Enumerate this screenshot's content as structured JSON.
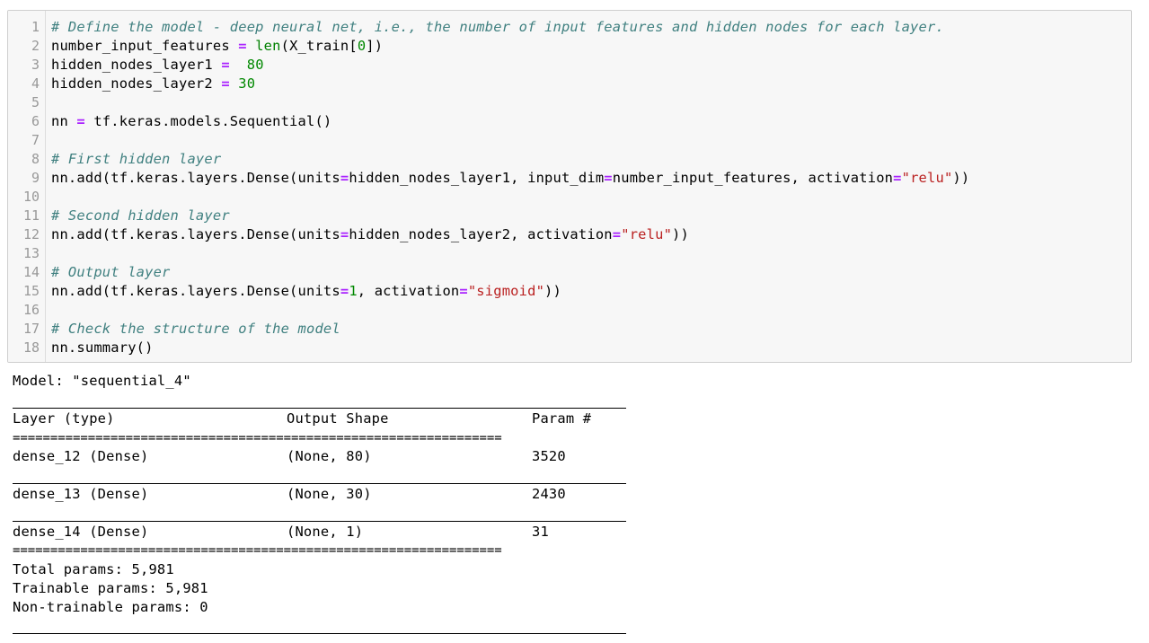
{
  "code_cell": {
    "line_numbers": [
      "1",
      "2",
      "3",
      "4",
      "5",
      "6",
      "7",
      "8",
      "9",
      "10",
      "11",
      "12",
      "13",
      "14",
      "15",
      "16",
      "17",
      "18"
    ],
    "lines": [
      [
        {
          "t": "# Define the model - deep neural net, i.e., the number of input features and hidden nodes for each layer.",
          "c": "cm"
        }
      ],
      [
        {
          "t": "number_input_features ",
          "c": ""
        },
        {
          "t": "=",
          "c": "op"
        },
        {
          "t": " ",
          "c": ""
        },
        {
          "t": "len",
          "c": "bi"
        },
        {
          "t": "(X_train[",
          "c": ""
        },
        {
          "t": "0",
          "c": "num"
        },
        {
          "t": "])",
          "c": ""
        }
      ],
      [
        {
          "t": "hidden_nodes_layer1 ",
          "c": ""
        },
        {
          "t": "=",
          "c": "op"
        },
        {
          "t": "  ",
          "c": ""
        },
        {
          "t": "80",
          "c": "num"
        }
      ],
      [
        {
          "t": "hidden_nodes_layer2 ",
          "c": ""
        },
        {
          "t": "=",
          "c": "op"
        },
        {
          "t": " ",
          "c": ""
        },
        {
          "t": "30",
          "c": "num"
        }
      ],
      [],
      [
        {
          "t": "nn ",
          "c": ""
        },
        {
          "t": "=",
          "c": "op"
        },
        {
          "t": " tf.keras.models.Sequential()",
          "c": ""
        }
      ],
      [],
      [
        {
          "t": "# First hidden layer",
          "c": "cm"
        }
      ],
      [
        {
          "t": "nn.add(tf.keras.layers.Dense(units",
          "c": ""
        },
        {
          "t": "=",
          "c": "op"
        },
        {
          "t": "hidden_nodes_layer1, input_dim",
          "c": ""
        },
        {
          "t": "=",
          "c": "op"
        },
        {
          "t": "number_input_features, activation",
          "c": ""
        },
        {
          "t": "=",
          "c": "op"
        },
        {
          "t": "\"relu\"",
          "c": "str"
        },
        {
          "t": "))",
          "c": ""
        }
      ],
      [],
      [
        {
          "t": "# Second hidden layer",
          "c": "cm"
        }
      ],
      [
        {
          "t": "nn.add(tf.keras.layers.Dense(units",
          "c": ""
        },
        {
          "t": "=",
          "c": "op"
        },
        {
          "t": "hidden_nodes_layer2, activation",
          "c": ""
        },
        {
          "t": "=",
          "c": "op"
        },
        {
          "t": "\"relu\"",
          "c": "str"
        },
        {
          "t": "))",
          "c": ""
        }
      ],
      [],
      [
        {
          "t": "# Output layer",
          "c": "cm"
        }
      ],
      [
        {
          "t": "nn.add(tf.keras.layers.Dense(units",
          "c": ""
        },
        {
          "t": "=",
          "c": "op"
        },
        {
          "t": "1",
          "c": "num"
        },
        {
          "t": ", activation",
          "c": ""
        },
        {
          "t": "=",
          "c": "op"
        },
        {
          "t": "\"sigmoid\"",
          "c": "str"
        },
        {
          "t": "))",
          "c": ""
        }
      ],
      [],
      [
        {
          "t": "# Check the structure of the model",
          "c": "cm"
        }
      ],
      [
        {
          "t": "nn.summary()",
          "c": ""
        }
      ]
    ]
  },
  "output": {
    "model_line": "Model: \"sequential_4\"",
    "header": {
      "layer": "Layer (type)",
      "shape": "Output Shape",
      "params": "Param #"
    },
    "rows": [
      {
        "layer": "dense_12 (Dense)",
        "shape": "(None, 80)",
        "params": "3520"
      },
      {
        "layer": "dense_13 (Dense)",
        "shape": "(None, 30)",
        "params": "2430"
      },
      {
        "layer": "dense_14 (Dense)",
        "shape": "(None, 1)",
        "params": "31"
      }
    ],
    "separator": "=================================================================",
    "total_params": "Total params: 5,981",
    "trainable_params": "Trainable params: 5,981",
    "non_trainable_params": "Non-trainable params: 0"
  }
}
